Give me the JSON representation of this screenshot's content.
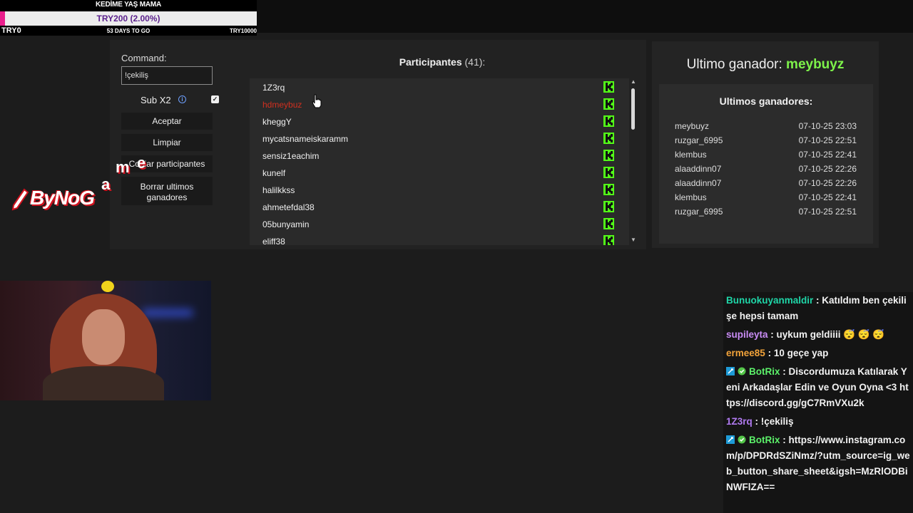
{
  "goal": {
    "title": "KEDİME YAŞ MAMA",
    "percent_label": "TRY200 (2.00%)",
    "progress": 0.02,
    "start_label": "TRY0",
    "days_label": "53 DAYS TO GO",
    "end_label": "TRY10000"
  },
  "controls": {
    "command_label": "Command:",
    "command_value": "!çekiliş",
    "sub_label": "Sub X2",
    "info_glyph": "i",
    "checkbox_glyph": "✓",
    "aceptar": "Aceptar",
    "limpiar": "Limpiar",
    "copiar": "Copiar participantes",
    "borrar_line1": "Borrar ultimos",
    "borrar_line2": "ganadores"
  },
  "participants": {
    "title": "Participantes",
    "count": "(41):",
    "colon": "",
    "list": [
      {
        "name": "1Z3rq",
        "highlight": false
      },
      {
        "name": "hdmeybuz",
        "highlight": true
      },
      {
        "name": "kheggY",
        "highlight": false
      },
      {
        "name": "mycatsnameiskaramm",
        "highlight": false
      },
      {
        "name": "sensiz1eachim",
        "highlight": false
      },
      {
        "name": "kunelf",
        "highlight": false
      },
      {
        "name": "halilkkss",
        "highlight": false
      },
      {
        "name": "ahmetefdal38",
        "highlight": false
      },
      {
        "name": "05bunyamin",
        "highlight": false
      },
      {
        "name": "eliff38",
        "highlight": false
      }
    ],
    "kick_color": "#53fc18"
  },
  "winners": {
    "last_label": "Ultimo ganador:",
    "last_name": "meybuyz",
    "list_title": "Ultimos ganadores:",
    "list": [
      {
        "name": "meybuyz",
        "date": "07-10-25 23:03"
      },
      {
        "name": "ruzgar_6995",
        "date": "07-10-25 22:51"
      },
      {
        "name": "klembus",
        "date": "07-10-25 22:41"
      },
      {
        "name": "alaaddinn07",
        "date": "07-10-25 22:26"
      },
      {
        "name": "alaaddinn07",
        "date": "07-10-25 22:26"
      },
      {
        "name": "klembus",
        "date": "07-10-25 22:41"
      },
      {
        "name": "ruzgar_6995",
        "date": "07-10-25 22:51"
      }
    ],
    "accent": "#7df24a"
  },
  "logo": {
    "text": "ByNoG",
    "letters": [
      "a",
      "m",
      "e"
    ]
  },
  "chat": {
    "messages": [
      {
        "user": "Bunuokuyanmaldir",
        "color": "#1fd6a8",
        "badges": false,
        "text": "Katıldım ben çekilişe hepsi tamam"
      },
      {
        "user": "supileyta",
        "color": "#c98cf5",
        "badges": false,
        "text": "uykum geldiiii 😴 😴 😴"
      },
      {
        "user": "ermee85",
        "color": "#f2a33a",
        "badges": false,
        "text": "10 geçe yap"
      },
      {
        "user": "BotRix",
        "color": "#5cf26a",
        "badges": true,
        "text": "Discordumuza Katılarak Yeni Arkadaşlar Edin ve Oyun Oyna <3 https://discord.gg/gC7RmVXu2k"
      },
      {
        "user": "1Z3rq",
        "color": "#b07af0",
        "badges": false,
        "text": "!çekiliş"
      },
      {
        "user": "BotRix",
        "color": "#5cf26a",
        "badges": true,
        "text": "https://www.instagram.com/p/DPDRdSZiNmz/?utm_source=ig_web_button_share_sheet&igsh=MzRlODBiNWFlZA=="
      }
    ],
    "separator": " : "
  }
}
